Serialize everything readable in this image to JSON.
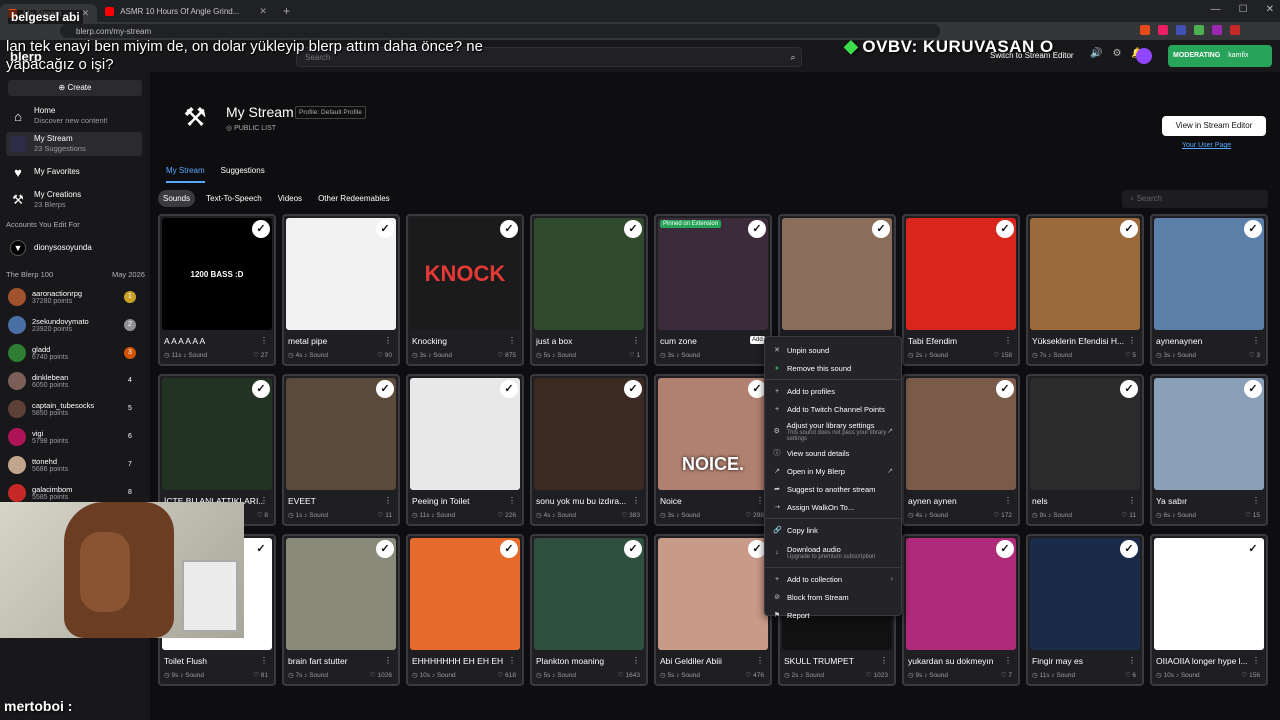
{
  "browser": {
    "tabs": [
      {
        "title": "My Stream"
      },
      {
        "title": "ASMR 10 Hours Of Angle Grind..."
      }
    ],
    "new_tab": "+",
    "url": "blerp.com/my-stream"
  },
  "overlay": {
    "channel": "belgesel abi",
    "message": "lan tek enayi ben miyim de, on dolar yükleyip blerp attım daha önce? ne yapacağız o işi?",
    "banner": "OVBV: KURUVASAN O",
    "chat_user": "mertoboi :"
  },
  "nav": {
    "brand": "blerp",
    "search_placeholder": "Search",
    "stream_editor": "Switch to Stream Editor",
    "moderating": "MODERATING",
    "mod_user": "kamfix"
  },
  "sidebar": {
    "create": "Create",
    "items": [
      {
        "label": "Home",
        "sub": "Discover new content!"
      },
      {
        "label": "My Stream",
        "sub": "23 Suggestions"
      },
      {
        "label": "My Favorites",
        "sub": ""
      },
      {
        "label": "My Creations",
        "sub": "23 Blerps"
      }
    ],
    "edit_header": "Accounts You Edit For",
    "edit_account": "dionysosoyunda",
    "b100_header": "The Blerp 100",
    "b100_date": "May 2026",
    "b100": [
      {
        "name": "aaronactionrpg",
        "points": "37280 points",
        "rank": "1",
        "color": "#c9a227"
      },
      {
        "name": "2sekundovymato",
        "points": "23920 points",
        "rank": "2",
        "color": "#8f8f95"
      },
      {
        "name": "gladd",
        "points": "6740 points",
        "rank": "3",
        "color": "#d35400"
      },
      {
        "name": "dinklebean",
        "points": "6050 points",
        "rank": "4",
        "color": "transparent"
      },
      {
        "name": "captain_tubesocks",
        "points": "5850 points",
        "rank": "5",
        "color": "transparent"
      },
      {
        "name": "vigi",
        "points": "5798 points",
        "rank": "6",
        "color": "transparent"
      },
      {
        "name": "ttonehd",
        "points": "5686 points",
        "rank": "7",
        "color": "transparent"
      },
      {
        "name": "galacimbom",
        "points": "5585 points",
        "rank": "8",
        "color": "transparent"
      }
    ]
  },
  "header": {
    "title": "My Stream",
    "badge": "Profile: Default Profile",
    "visibility": "PUBLIC LIST",
    "view_editor": "View in Stream Editor",
    "user_page": "Your User Page"
  },
  "tabs": [
    "My Stream",
    "Suggestions"
  ],
  "filters": [
    "Sounds",
    "Text-To-Speech",
    "Videos",
    "Other Redeemables"
  ],
  "search_placeholder": "Search",
  "cards": [
    {
      "title": "A A A A A A",
      "dur": "11s",
      "count": "27",
      "bg": "#000000",
      "text": "1200 BASS :D",
      "pinned": ""
    },
    {
      "title": "metal pipe",
      "dur": "4s",
      "count": "90",
      "bg": "#f2f2f2",
      "text": "",
      "pinned": ""
    },
    {
      "title": "Knocking",
      "dur": "3s",
      "count": "875",
      "bg": "#1b1b1b",
      "text": "KNOCK",
      "pinned": ""
    },
    {
      "title": "just a box",
      "dur": "5s",
      "count": "1",
      "bg": "#2f4a2c",
      "text": "",
      "pinned": ""
    },
    {
      "title": "cum zone",
      "dur": "3s",
      "count": "",
      "bg": "#3b2b3b",
      "text": "",
      "pinned": "Pinned on Extension"
    },
    {
      "title": "",
      "dur": "",
      "count": "",
      "bg": "#8a6d5a",
      "text": "",
      "pinned": ""
    },
    {
      "title": "Tabi Efendim",
      "dur": "2s",
      "count": "158",
      "bg": "#d9261c",
      "text": "",
      "pinned": ""
    },
    {
      "title": "Yükseklerin Efendisi H...",
      "dur": "7s",
      "count": "5",
      "bg": "#9a6a3b",
      "text": "",
      "pinned": ""
    },
    {
      "title": "aynenaynen",
      "dur": "3s",
      "count": "3",
      "bg": "#5b7fa8",
      "text": "",
      "pinned": ""
    },
    {
      "title": "İÇTE BU ANLATTIKLARI...",
      "dur": "",
      "count": "8",
      "bg": "#233323",
      "text": "",
      "pinned": ""
    },
    {
      "title": "EVEET",
      "dur": "1s",
      "count": "11",
      "bg": "#5a4a3a",
      "text": "",
      "pinned": ""
    },
    {
      "title": "Peeing in Toilet",
      "dur": "11s",
      "count": "226",
      "bg": "#e8e8e8",
      "text": "",
      "pinned": ""
    },
    {
      "title": "sonu yok mu bu izdıra...",
      "dur": "4s",
      "count": "383",
      "bg": "#3a2a22",
      "text": "",
      "pinned": ""
    },
    {
      "title": "Noice",
      "dur": "3s",
      "count": "298",
      "bg": "#b08070",
      "text": "NOICE.",
      "pinned": ""
    },
    {
      "title": "",
      "dur": "",
      "count": "",
      "bg": "#4a3a30",
      "text": "",
      "pinned": ""
    },
    {
      "title": "aynen aynen",
      "dur": "4s",
      "count": "172",
      "bg": "#7a5a48",
      "text": "",
      "pinned": ""
    },
    {
      "title": "nels",
      "dur": "9s",
      "count": "11",
      "bg": "#2b2b2b",
      "text": "",
      "pinned": ""
    },
    {
      "title": "Ya sabır",
      "dur": "6s",
      "count": "15",
      "bg": "#8aa0b8",
      "text": "",
      "pinned": ""
    },
    {
      "title": "Toilet Flush",
      "dur": "9s",
      "count": "81",
      "bg": "#ffffff",
      "text": "",
      "pinned": ""
    },
    {
      "title": "brain fart stutter",
      "dur": "7s",
      "count": "1026",
      "bg": "#8a8a7a",
      "text": "",
      "pinned": ""
    },
    {
      "title": "EHHHHHHH EH EH EH",
      "dur": "10s",
      "count": "618",
      "bg": "#e56a2c",
      "text": "",
      "pinned": ""
    },
    {
      "title": "Plankton moaning",
      "dur": "5s",
      "count": "1643",
      "bg": "#2f4f3f",
      "text": "",
      "pinned": ""
    },
    {
      "title": "Abi Geldiler Abiii",
      "dur": "5s",
      "count": "476",
      "bg": "#c89a88",
      "text": "",
      "pinned": ""
    },
    {
      "title": "SKULL TRUMPET",
      "dur": "2s",
      "count": "1023",
      "bg": "#111111",
      "text": "",
      "pinned": ""
    },
    {
      "title": "yukardan su dokmeyın",
      "dur": "9s",
      "count": "7",
      "bg": "#b02a7a",
      "text": "",
      "pinned": ""
    },
    {
      "title": "Fingir may es",
      "dur": "11s",
      "count": "6",
      "bg": "#1a2b4a",
      "text": "",
      "pinned": ""
    },
    {
      "title": "OIIAOIIA longer hype l...",
      "dur": "10s",
      "count": "156",
      "bg": "#ffffff",
      "text": "",
      "pinned": ""
    }
  ],
  "context_menu": {
    "tooltip": "Add",
    "items": [
      {
        "label": "Unpin sound",
        "sub": "",
        "icon": "pin-icon"
      },
      {
        "label": "Remove this sound",
        "sub": "",
        "icon": "check-circle-icon"
      },
      {
        "label": "Add to profiles",
        "sub": "",
        "icon": "plus-icon"
      },
      {
        "label": "Add to Twitch Channel Points",
        "sub": "",
        "icon": "plus-icon"
      },
      {
        "label": "Adjust your library settings",
        "sub": "This sound does not pass your library settings",
        "icon": "gear-icon"
      },
      {
        "label": "View sound details",
        "sub": "",
        "icon": "info-icon"
      },
      {
        "label": "Open in My Blerp",
        "sub": "",
        "icon": "external-icon"
      },
      {
        "label": "Suggest to another stream",
        "sub": "",
        "icon": "share-icon"
      },
      {
        "label": "Assign WalkOn To...",
        "sub": "",
        "icon": "walk-icon"
      },
      {
        "label": "Copy link",
        "sub": "",
        "icon": "link-icon"
      },
      {
        "label": "Download audio",
        "sub": "Upgrade to premium subscription",
        "icon": "download-icon"
      },
      {
        "label": "Add to collection",
        "sub": "",
        "icon": "plus-icon"
      },
      {
        "label": "Block from Stream",
        "sub": "",
        "icon": "block-icon"
      },
      {
        "label": "Report",
        "sub": "",
        "icon": "flag-icon"
      }
    ]
  }
}
